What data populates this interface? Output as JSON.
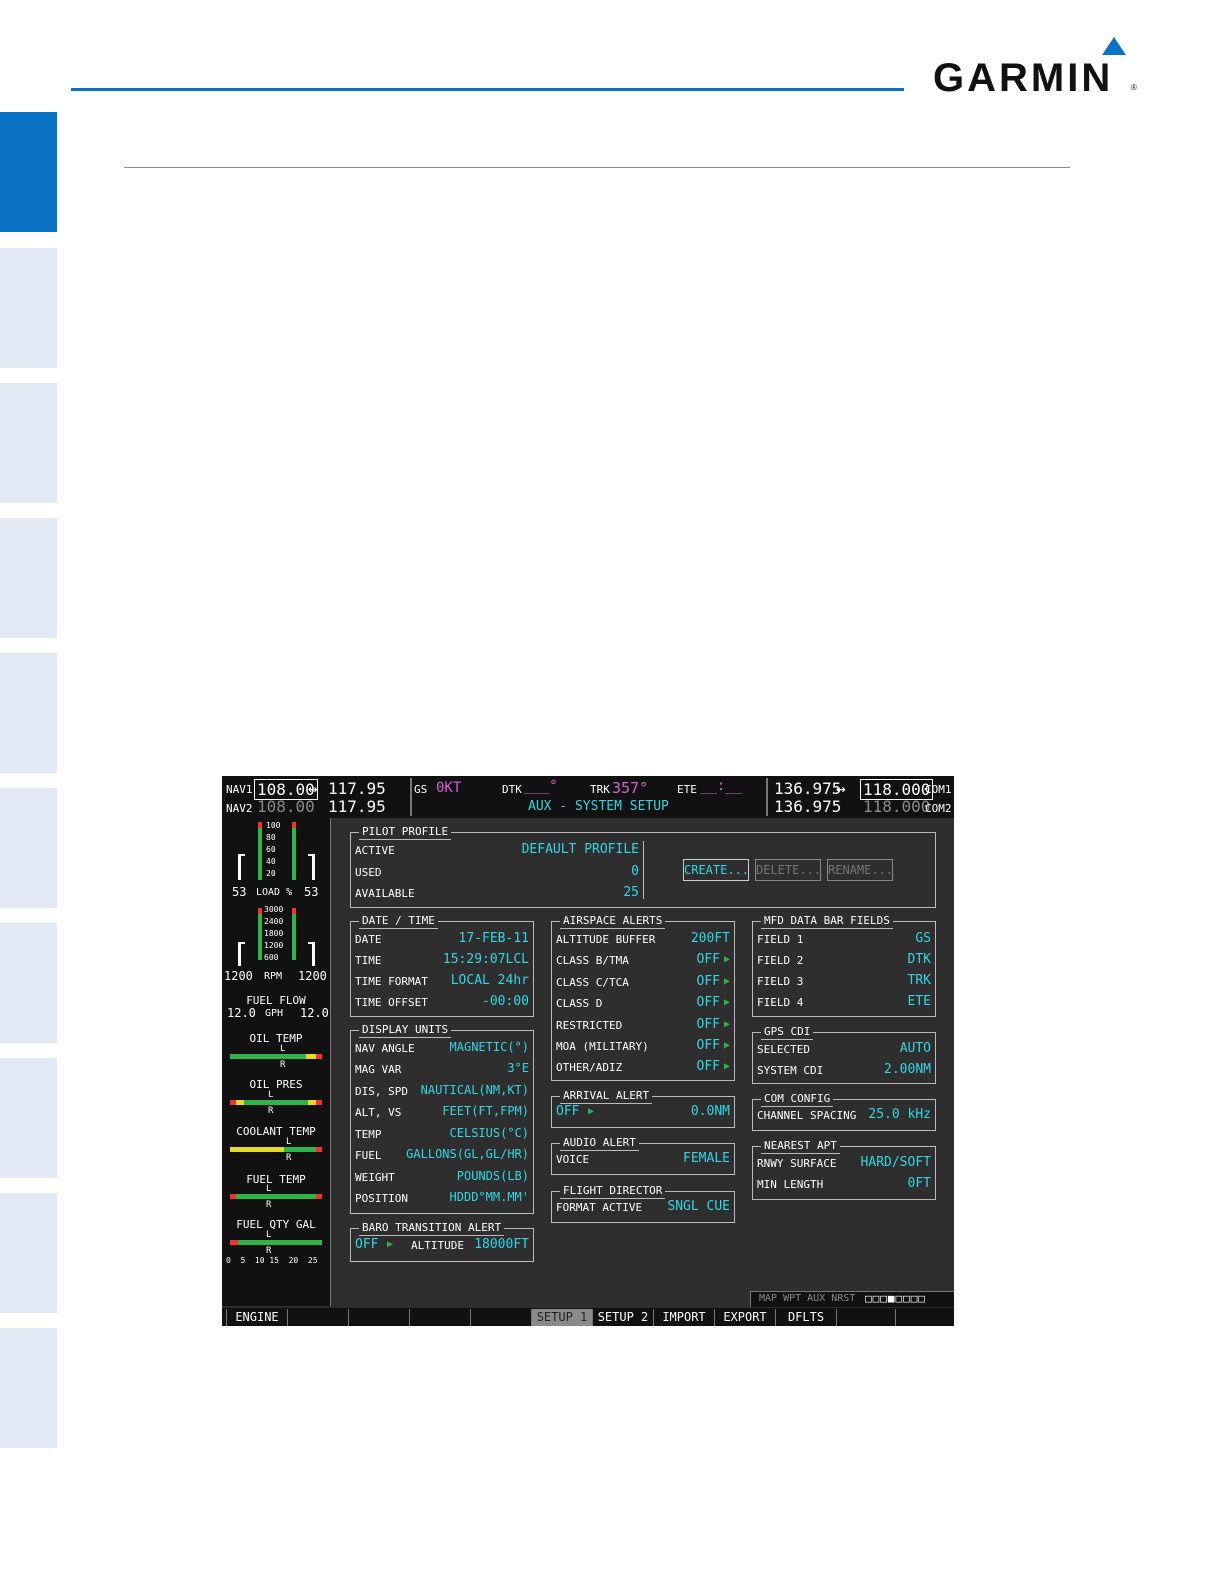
{
  "brand": {
    "name": "GARMIN",
    "registered": "®"
  },
  "mfd": {
    "topbar": {
      "nav1_label": "NAV1",
      "nav1_active": "108.00",
      "nav1_standby": "117.95",
      "nav2_label": "NAV2",
      "nav2_active": "108.00",
      "nav2_standby": "117.95",
      "swap_symbol": "↔",
      "gs_label": "GS",
      "gs_value": "0KT",
      "dtk_label": "DTK",
      "dtk_value": "___°",
      "trk_label": "TRK",
      "trk_value": "357°",
      "ete_label": "ETE",
      "ete_value": "__:__",
      "page_title": "AUX - SYSTEM SETUP",
      "com1_standby": "136.975",
      "com1_active": "118.000",
      "com1_label": "COM1",
      "com2_standby": "136.975",
      "com2_active": "118.000",
      "com2_label": "COM2"
    },
    "eis": {
      "load_ticks": [
        "100",
        "80",
        "60",
        "40",
        "20"
      ],
      "load_left": "53",
      "load_label": "LOAD %",
      "load_right": "53",
      "rpm_ticks": [
        "3000",
        "2400",
        "1800",
        "1200",
        "600"
      ],
      "rpm_left": "1200",
      "rpm_label": "RPM",
      "rpm_right": "1200",
      "fuel_flow_label": "FUEL FLOW",
      "fuel_flow_left": "12.0",
      "fuel_flow_unit": "GPH",
      "fuel_flow_right": "12.0",
      "oil_temp_label": "OIL TEMP",
      "oil_pres_label": "OIL PRES",
      "coolant_temp_label": "COOLANT TEMP",
      "fuel_temp_label": "FUEL TEMP",
      "fuel_qty_label": "FUEL QTY GAL",
      "fuel_qty_scale": "0  5  10 15  20  25",
      "pointer_left": "L",
      "pointer_right": "R"
    },
    "pilot_profile": {
      "title": "PILOT PROFILE",
      "active_label": "ACTIVE",
      "active_value": "DEFAULT PROFILE",
      "used_label": "USED",
      "used_value": "0",
      "available_label": "AVAILABLE",
      "available_value": "25",
      "create_btn": "CREATE...",
      "delete_btn": "DELETE...",
      "rename_btn": "RENAME..."
    },
    "date_time": {
      "title": "DATE / TIME",
      "rows": [
        {
          "k": "DATE",
          "v": "17-FEB-11"
        },
        {
          "k": "TIME",
          "v": "15:29:07LCL"
        },
        {
          "k": "TIME FORMAT",
          "v": "LOCAL 24hr"
        },
        {
          "k": "TIME OFFSET",
          "v": "-00:00"
        }
      ]
    },
    "display_units": {
      "title": "DISPLAY UNITS",
      "rows": [
        {
          "k": "NAV ANGLE",
          "v": "MAGNETIC(°)"
        },
        {
          "k": "MAG VAR",
          "v": "3°E"
        },
        {
          "k": "DIS, SPD",
          "v": "NAUTICAL(NM,KT)"
        },
        {
          "k": "ALT, VS",
          "v": "FEET(FT,FPM)"
        },
        {
          "k": "TEMP",
          "v": "CELSIUS(°C)"
        },
        {
          "k": "FUEL",
          "v": "GALLONS(GL,GL/HR)"
        },
        {
          "k": "WEIGHT",
          "v": "POUNDS(LB)"
        },
        {
          "k": "POSITION",
          "v": "HDDD°MM.MM'"
        }
      ]
    },
    "baro_transition": {
      "title": "BARO TRANSITION ALERT",
      "state": "OFF",
      "altitude_label": "ALTITUDE",
      "altitude_value": "18000FT"
    },
    "airspace_alerts": {
      "title": "AIRSPACE ALERTS",
      "rows": [
        {
          "k": "ALTITUDE BUFFER",
          "v": "200FT"
        },
        {
          "k": "CLASS B/TMA",
          "v": "OFF"
        },
        {
          "k": "CLASS C/TCA",
          "v": "OFF"
        },
        {
          "k": "CLASS D",
          "v": "OFF"
        },
        {
          "k": "RESTRICTED",
          "v": "OFF"
        },
        {
          "k": "MOA (MILITARY)",
          "v": "OFF"
        },
        {
          "k": "OTHER/ADIZ",
          "v": "OFF"
        }
      ]
    },
    "arrival_alert": {
      "title": "ARRIVAL ALERT",
      "state": "OFF",
      "value": "0.0NM"
    },
    "audio_alert": {
      "title": "AUDIO ALERT",
      "label": "VOICE",
      "value": "FEMALE"
    },
    "flight_director": {
      "title": "FLIGHT DIRECTOR",
      "label": "FORMAT ACTIVE",
      "value": "SNGL CUE"
    },
    "mfd_data_bar": {
      "title": "MFD DATA BAR FIELDS",
      "rows": [
        {
          "k": "FIELD 1",
          "v": "GS"
        },
        {
          "k": "FIELD 2",
          "v": "DTK"
        },
        {
          "k": "FIELD 3",
          "v": "TRK"
        },
        {
          "k": "FIELD 4",
          "v": "ETE"
        }
      ]
    },
    "gps_cdi": {
      "title": "GPS CDI",
      "selected_label": "SELECTED",
      "selected_value": "AUTO",
      "system_label": "SYSTEM CDI",
      "system_value": "2.00NM"
    },
    "com_config": {
      "title": "COM CONFIG",
      "label": "CHANNEL SPACING",
      "value": "25.0 kHz"
    },
    "nearest_apt": {
      "title": "NEAREST APT",
      "surface_label": "RNWY SURFACE",
      "surface_value": "HARD/SOFT",
      "length_label": "MIN LENGTH",
      "length_value": "0FT"
    },
    "page_group": {
      "text": "MAP WPT AUX NRST",
      "boxes": "□□□■□□□□"
    },
    "softkeys": [
      "ENGINE",
      "",
      "",
      "",
      "",
      "SETUP 1",
      "SETUP 2",
      "IMPORT",
      "EXPORT",
      "DFLTS",
      "",
      ""
    ]
  },
  "colors": {
    "accent_blue": "#0a72c4",
    "tab_light": "#e2e9f4",
    "mfd_cyan": "#33d6e6",
    "mfd_magenta": "#d65fd6"
  }
}
